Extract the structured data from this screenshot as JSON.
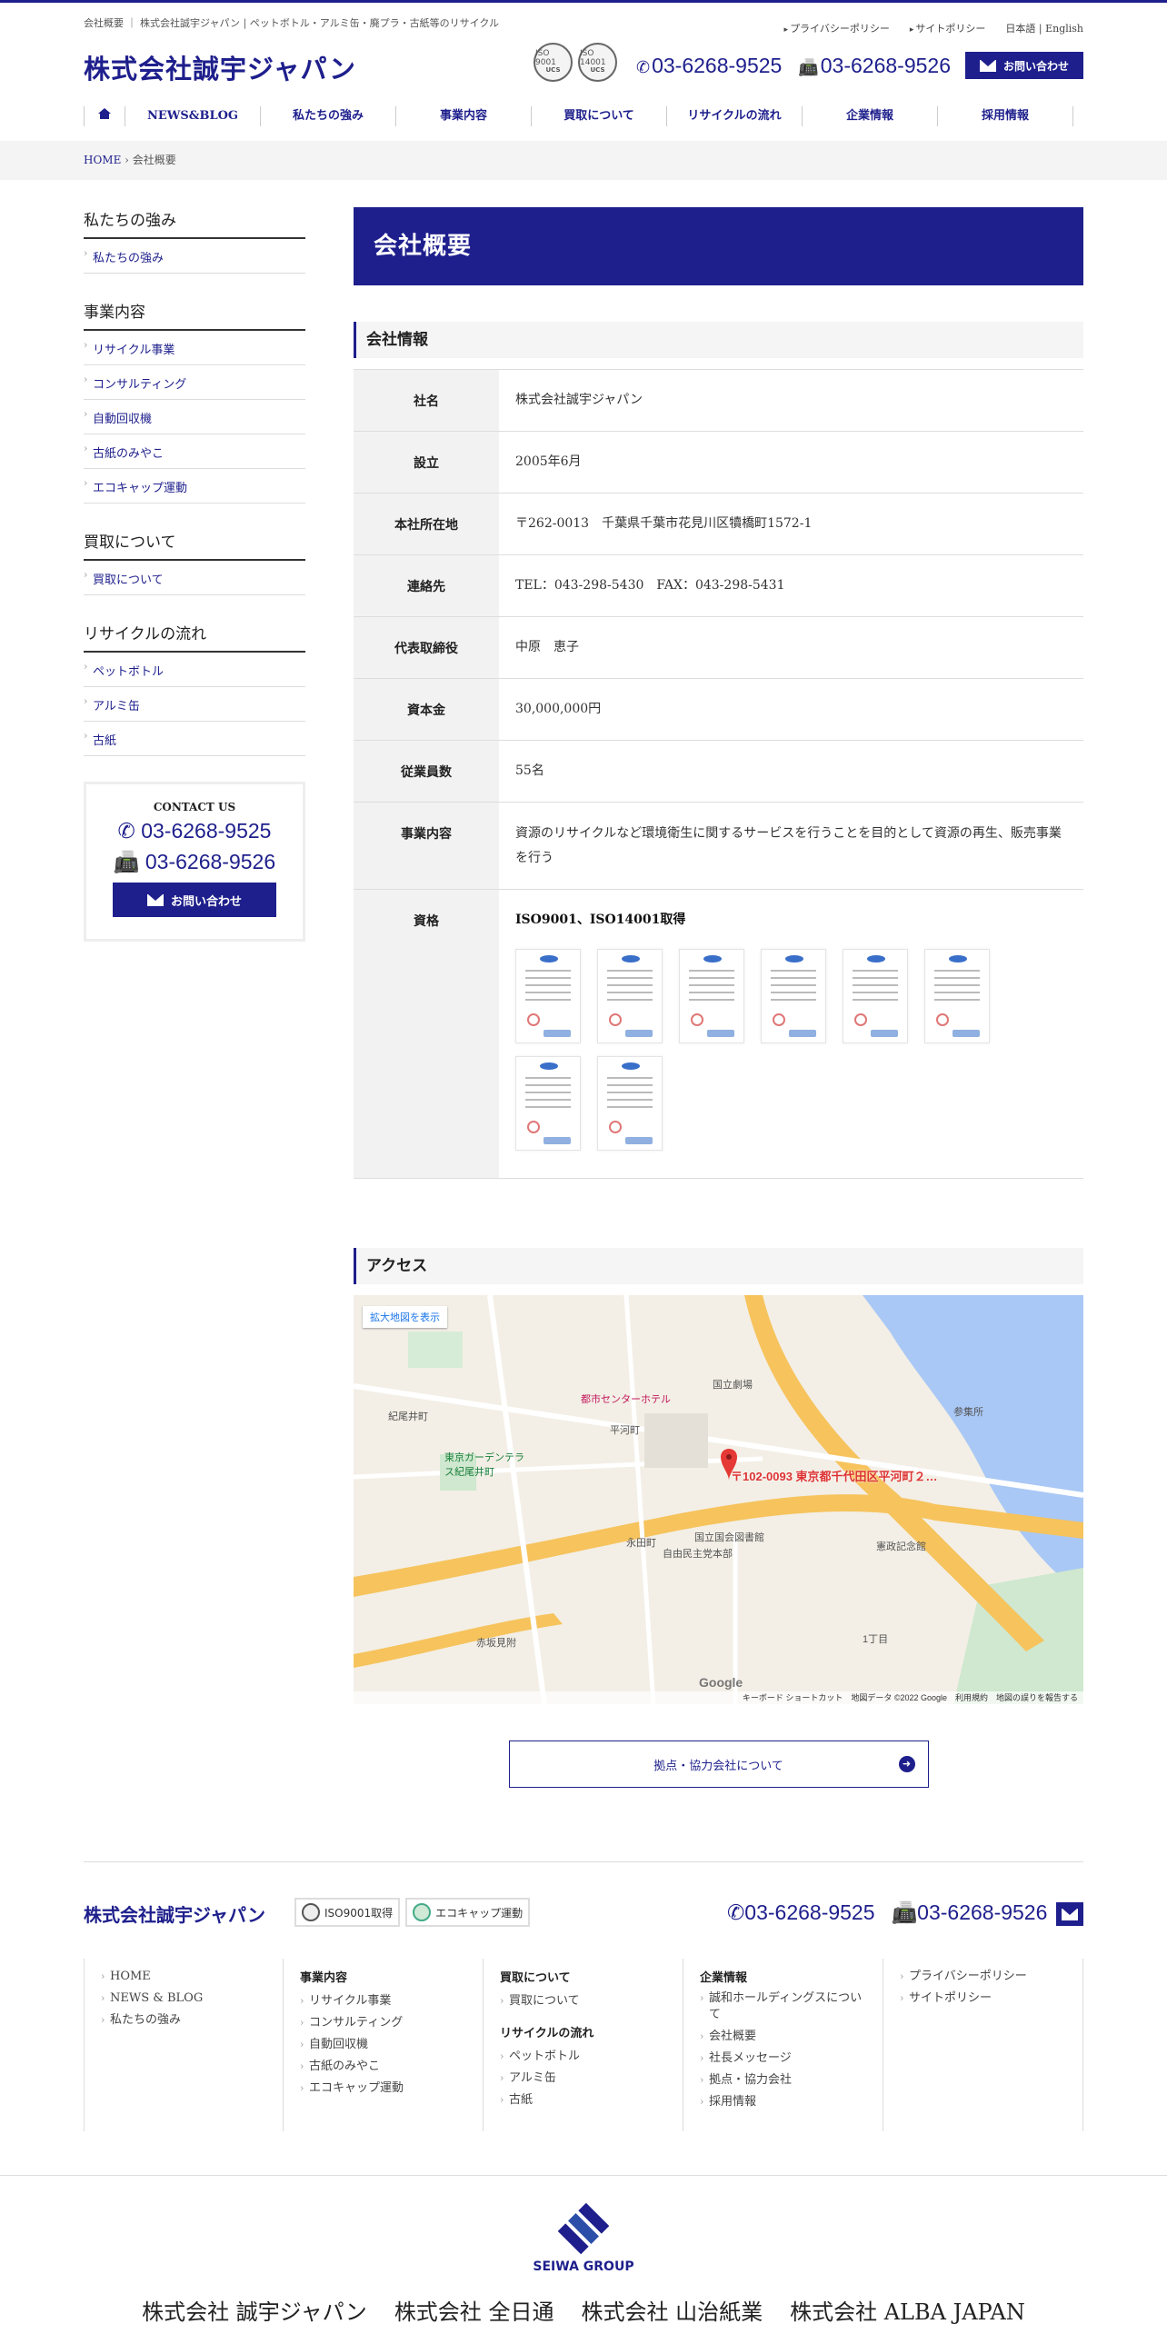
{
  "header": {
    "tagline": "会社概要 ｜ 株式会社誠宇ジャパン | ペットボトル・アルミ缶・廃プラ・古紙等のリサイクル",
    "privacy": "プライバシーポリシー",
    "sitepolicy": "サイトポリシー",
    "lang": "日本語 | English",
    "logo": "株式会社誠宇ジャパン",
    "iso1": "ISO 9001",
    "iso2": "ISO 14001",
    "iso_mark": "UCS",
    "tel": "03-6268-9525",
    "fax": "03-6268-9526",
    "contact": "お問い合わせ"
  },
  "nav": [
    "NEWS&BLOG",
    "私たちの強み",
    "事業内容",
    "買取について",
    "リサイクルの流れ",
    "企業情報",
    "採用情報"
  ],
  "breadcrumb": {
    "home": "HOME",
    "current": "会社概要"
  },
  "sidebar": {
    "groups": [
      {
        "title": "私たちの強み",
        "items": [
          "私たちの強み"
        ]
      },
      {
        "title": "事業内容",
        "items": [
          "リサイクル事業",
          "コンサルティング",
          "自動回収機",
          "古紙のみやこ",
          "エコキャップ運動"
        ]
      },
      {
        "title": "買取について",
        "items": [
          "買取について"
        ]
      },
      {
        "title": "リサイクルの流れ",
        "items": [
          "ペットボトル",
          "アルミ缶",
          "古紙"
        ]
      }
    ],
    "contact_title": "CONTACT US",
    "tel": "03-6268-9525",
    "fax": "03-6268-9526",
    "contact_button": "お問い合わせ"
  },
  "page": {
    "title": "会社概要",
    "section_info": "会社情報",
    "rows": [
      {
        "k": "社名",
        "v": "株式会社誠宇ジャパン"
      },
      {
        "k": "設立",
        "v": "2005年6月"
      },
      {
        "k": "本社所在地",
        "v": "〒262-0013　千葉県千葉市花見川区犢橋町1572-1"
      },
      {
        "k": "連絡先",
        "v": "TEL：043-298-5430　FAX：043-298-5431"
      },
      {
        "k": "代表取締役",
        "v": "中原　恵子"
      },
      {
        "k": "資本金",
        "v": "30,000,000円"
      },
      {
        "k": "従業員数",
        "v": "55名"
      },
      {
        "k": "事業内容",
        "v": "資源のリサイクルなど環境衛生に関するサービスを行うことを目的として資源の再生、販売事業を行う"
      }
    ],
    "cert_key": "資格",
    "cert_title": "ISO9001、ISO14001取得",
    "section_access": "アクセス",
    "map_link": "拡大地図を表示",
    "map_address": "〒102-0093 東京都千代田区平河町２…",
    "map_labels": [
      "平河町",
      "紀尾井町",
      "永田町",
      "国立国会図書館",
      "自由民主党本部",
      "憲政記念館",
      "国立劇場",
      "参集所",
      "東京ガーデンテラス紀尾井町",
      "都市センターホテル",
      "赤坂見附",
      "1丁目"
    ],
    "map_footer": "キーボード ショートカット　地図データ ©2022 Google　利用規約　地図の誤りを報告する",
    "map_google": "Google",
    "more_button": "拠点・協力会社について"
  },
  "footer": {
    "logo": "株式会社誠宇ジャパン",
    "badge1": "ISO9001取得",
    "badge2": "エコキャップ運動",
    "tel": "03-6268-9525",
    "fax": "03-6268-9526",
    "col1": [
      "HOME",
      "NEWS & BLOG",
      "私たちの強み"
    ],
    "col2_title": "事業内容",
    "col2": [
      "リサイクル事業",
      "コンサルティング",
      "自動回収機",
      "古紙のみやこ",
      "エコキャップ運動"
    ],
    "col3_title": "買取について",
    "col3a": [
      "買取について"
    ],
    "col3_title2": "リサイクルの流れ",
    "col3b": [
      "ペットボトル",
      "アルミ缶",
      "古紙"
    ],
    "col4_title": "企業情報",
    "col4": [
      "誠和ホールディングスについて",
      "会社概要",
      "社長メッセージ",
      "拠点・協力会社",
      "採用情報"
    ],
    "col5": [
      "プライバシーポリシー",
      "サイトポリシー"
    ],
    "group": "SEIWA GROUP",
    "companies": [
      "株式会社 誠宇ジャパン",
      "株式会社 全日通",
      "株式会社 山治紙業",
      "株式会社 ALBA JAPAN"
    ]
  },
  "colors": {
    "brand": "#1e1f8c",
    "map_pin": "#d33"
  }
}
